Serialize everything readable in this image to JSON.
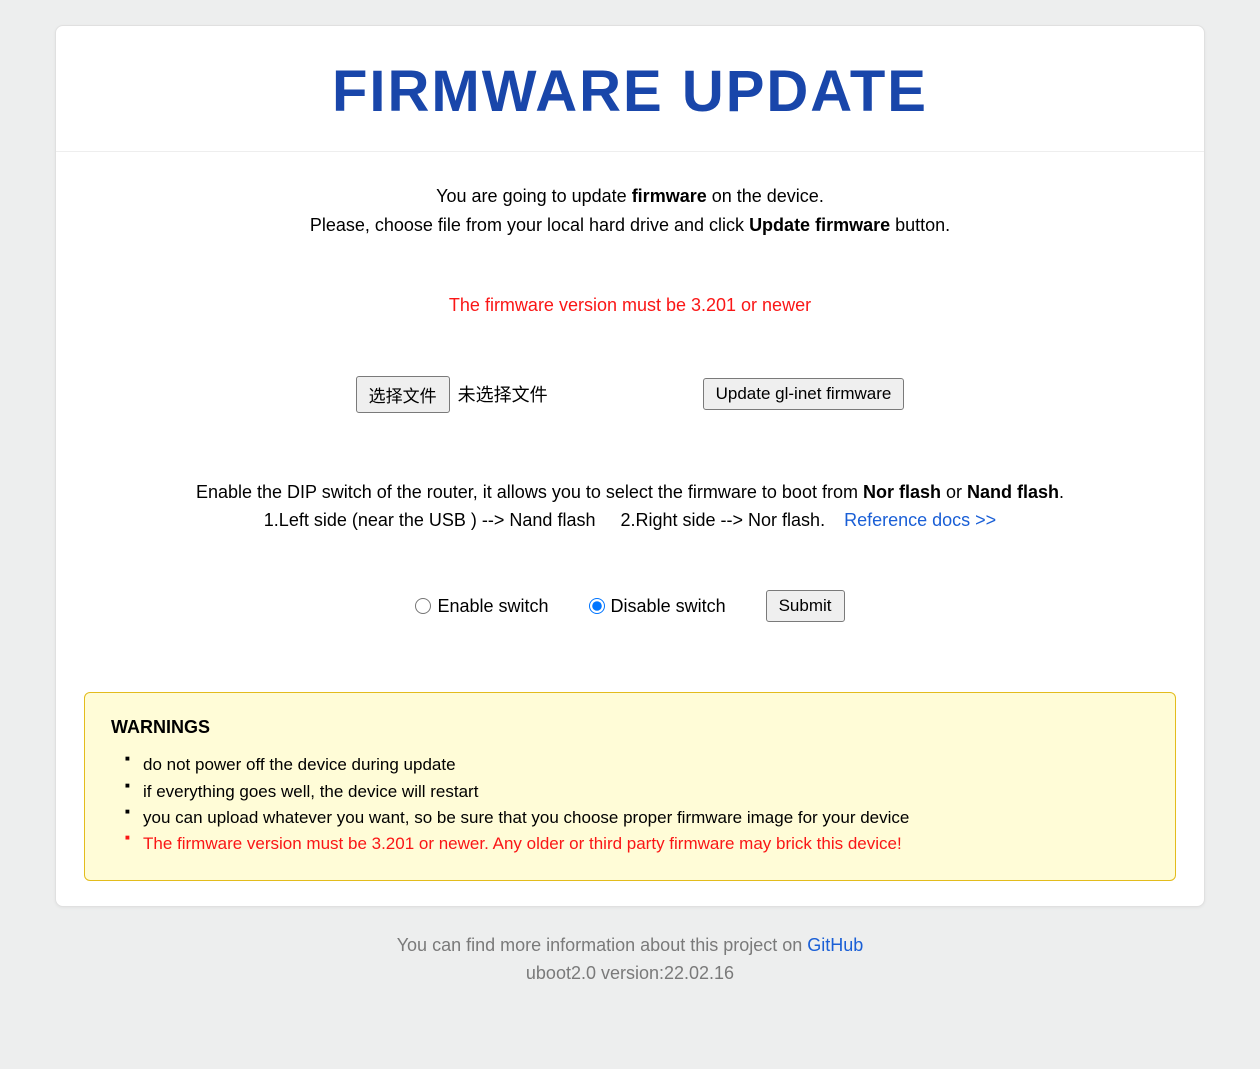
{
  "header": {
    "title": "FIRMWARE UPDATE"
  },
  "intro": {
    "line1_pre": "You are going to update ",
    "line1_bold": "firmware",
    "line1_post": " on the device.",
    "line2_pre": "Please, choose file from your local hard drive and click ",
    "line2_bold": "Update firmware",
    "line2_post": " button."
  },
  "version_warning": "The firmware version must be 3.201 or newer",
  "file": {
    "choose_label": "选择文件",
    "status_text": "未选择文件",
    "update_button": "Update gl-inet firmware"
  },
  "dip": {
    "line1_pre": "Enable the DIP switch of the router, it allows you to select the firmware to boot from ",
    "line1_bold1": "Nor flash",
    "line1_mid": " or ",
    "line1_bold2": "Nand flash",
    "line1_post": ".",
    "line2_left": "1.Left side (near the USB ) --> Nand flash",
    "line2_right": "2.Right side --> Nor flash.",
    "link_text": "Reference docs >>"
  },
  "switch": {
    "enable_label": "Enable switch",
    "disable_label": "Disable switch",
    "submit_label": "Submit"
  },
  "warnings": {
    "title": "WARNINGS",
    "items": [
      "do not power off the device during update",
      "if everything goes well, the device will restart",
      "you can upload whatever you want, so be sure that you choose proper firmware image for your device"
    ],
    "red_item": "The firmware version must be 3.201 or newer. Any older or third party firmware may brick this device!"
  },
  "footer": {
    "text": "You can find more information about this project on ",
    "link": "GitHub",
    "version": "uboot2.0 version:22.02.16"
  }
}
